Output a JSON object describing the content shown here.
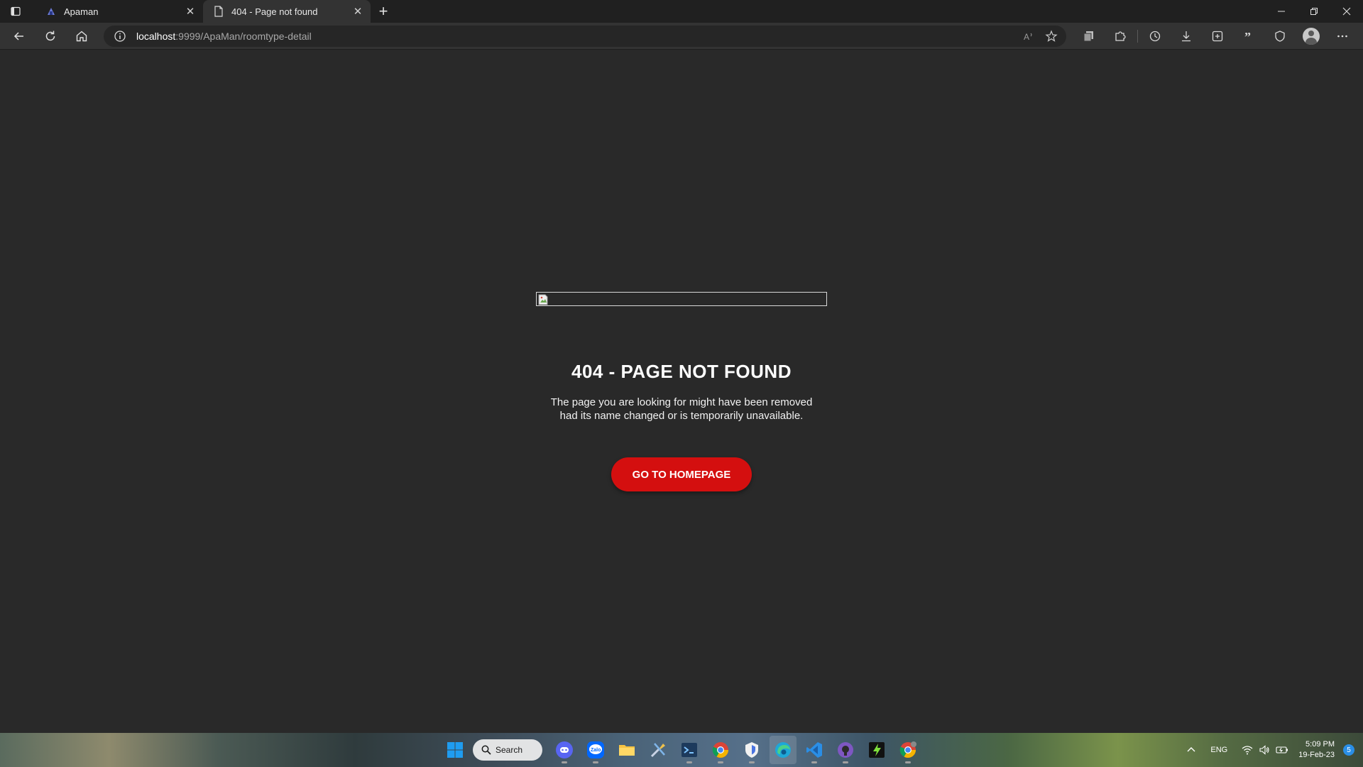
{
  "browser": {
    "tabs": [
      {
        "title": "Apaman",
        "active": false,
        "favicon": "apaman-icon"
      },
      {
        "title": "404 - Page not found",
        "active": true,
        "favicon": "page-icon"
      }
    ],
    "address": {
      "host": "localhost",
      "path": ":9999/ApaMan/roomtype-detail"
    }
  },
  "page": {
    "heading": "404 - PAGE NOT FOUND",
    "description_line1": "The page you are looking for might have been removed",
    "description_line2": "had its name changed or is temporarily unavailable.",
    "button_label": "GO TO HOMEPAGE",
    "accent_color": "#d40f0f",
    "background_color": "#292929"
  },
  "taskbar": {
    "search_label": "Search",
    "apps": [
      "windows-start",
      "discord",
      "zalo",
      "file-explorer",
      "tools",
      "terminal",
      "chrome",
      "vpn",
      "edge",
      "vscode",
      "github-desktop",
      "android-studio",
      "chrome-canary"
    ],
    "language": "ENG",
    "time": "5:09 PM",
    "date": "19-Feb-23",
    "notification_count": "5"
  }
}
